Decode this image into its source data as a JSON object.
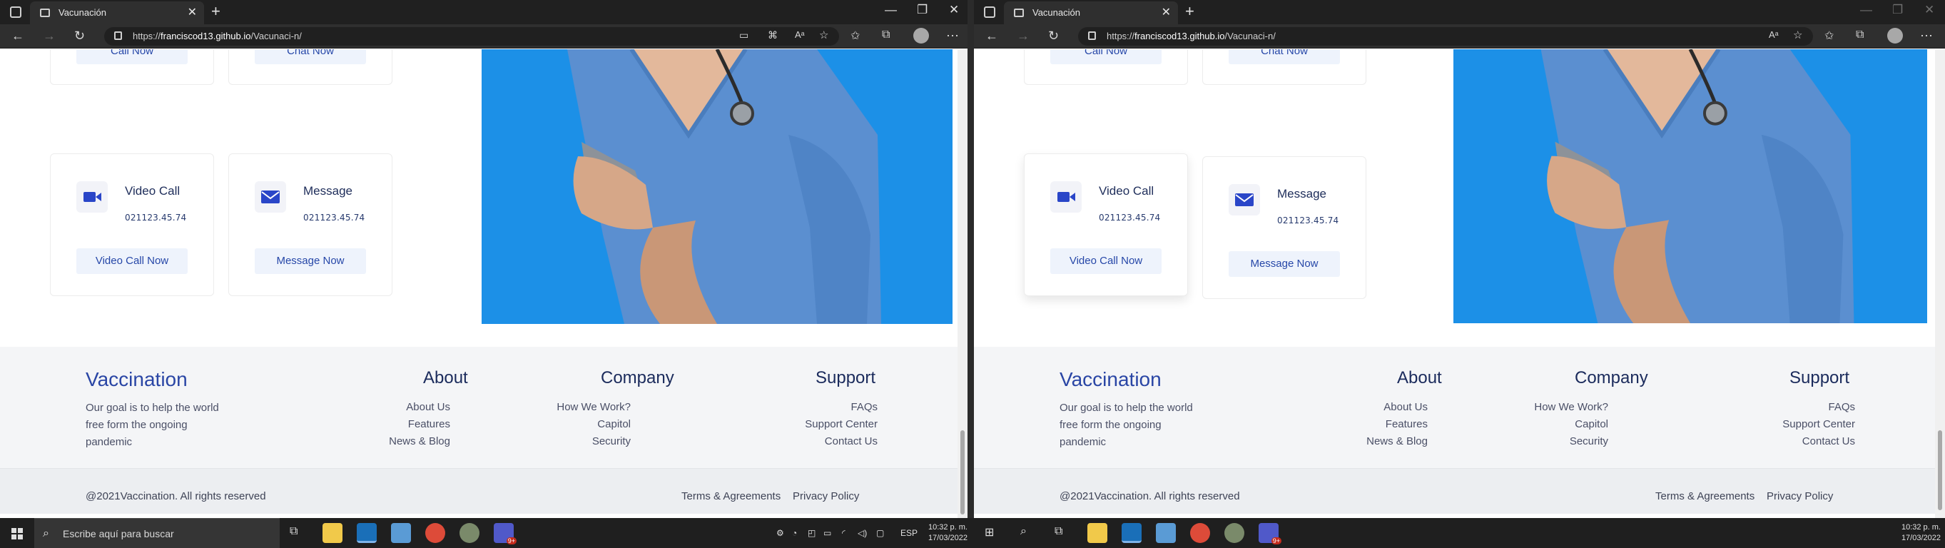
{
  "browser": {
    "tab_title": "Vacunación",
    "url_prefix": "https://",
    "url_host": "franciscod13.github.io",
    "url_path": "/Vacunaci-n/"
  },
  "contact_cards": {
    "phone_number": "021123.45.74",
    "call_now": "Call Now",
    "chat_now": "Chat Now",
    "video_call": {
      "title": "Video Call",
      "button": "Video Call Now"
    },
    "message": {
      "title": "Message",
      "button": "Message Now"
    }
  },
  "footer": {
    "brand": "Vaccination",
    "tagline": "Our goal is to help the world free form the ongoing pandemic",
    "about": {
      "heading": "About",
      "links": [
        "About Us",
        "Features",
        "News & Blog"
      ]
    },
    "company": {
      "heading": "Company",
      "links": [
        "How We Work?",
        "Capitol",
        "Security"
      ]
    },
    "support": {
      "heading": "Support",
      "links": [
        "FAQs",
        "Support Center",
        "Contact Us"
      ]
    },
    "copyright": "@2021Vaccination. All rights reserved",
    "terms": "Terms & Agreements",
    "privacy": "Privacy Policy"
  },
  "taskbar": {
    "search_placeholder": "Escribe aquí para buscar",
    "language": "ESP",
    "time": "10:32 p. m.",
    "date": "17/03/2022",
    "notification_badge": "9+"
  },
  "colors": {
    "brand_blue": "#2a46a5",
    "hero_blue": "#1c90e7",
    "scrub_blue": "#5b8fd0",
    "button_bg": "#eef3fc"
  },
  "icons": {
    "video": "video-camera-icon",
    "message": "envelope-icon"
  }
}
